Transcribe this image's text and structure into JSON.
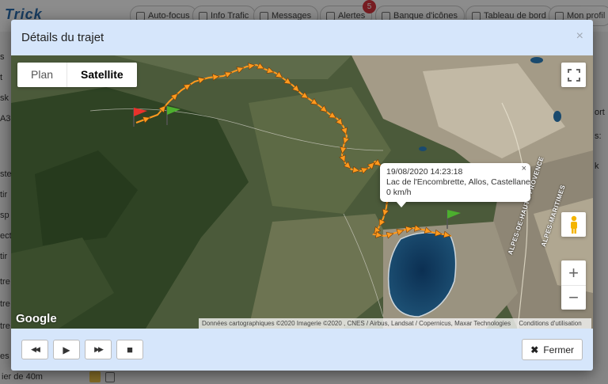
{
  "background": {
    "logo": "Trick",
    "nav": [
      {
        "label": "Auto-focus",
        "icon": "checkbox-icon"
      },
      {
        "label": "Info Trafic",
        "icon": "checkbox-icon"
      },
      {
        "label": "Messages",
        "icon": "envelope-icon"
      },
      {
        "label": "Alertes",
        "icon": "bell-icon"
      },
      {
        "label": "Banque d'icônes",
        "icon": "image-icon"
      },
      {
        "label": "Tableau de bord",
        "icon": "dashboard-icon"
      },
      {
        "label": "Mon profil",
        "icon": "user-icon"
      }
    ],
    "alerts_badge": "5",
    "sidebar_fragments": [
      "s",
      "t",
      "sk",
      "A3",
      "ste",
      "tir",
      "sp",
      "ect",
      "tir",
      "tre",
      "tre",
      "tre",
      "es"
    ],
    "right_fragments": [
      "ort",
      "s:",
      "k"
    ],
    "bottom_text": "ier de 40m"
  },
  "modal": {
    "title": "Détails du trajet",
    "close_symbol": "×"
  },
  "map": {
    "map_types": [
      "Plan",
      "Satellite"
    ],
    "active_map_type": "Satellite",
    "info_window": {
      "datetime": "19/08/2020 14:23:18",
      "address": "Lac de l'Encombrette, Allos, Castellane",
      "speed": "0 km/h",
      "close_symbol": "×"
    },
    "road_labels": [
      "ALPES-DE-HAUTE-PROVENCE",
      "ALPES-MARITIMES"
    ],
    "logo": "Google",
    "attribution": "Données cartographiques ©2020 Imagerie ©2020 , CNES / Airbus, Landsat / Copernicus, Maxar Technologies",
    "terms": "Conditions d'utilisation",
    "zoom_in": "+",
    "zoom_out": "−",
    "route_color": "#ff9a1f",
    "start_flag_color": "#e8322b",
    "end_flag_color": "#4caf2e"
  },
  "footer": {
    "buttons": [
      {
        "name": "rewind-button",
        "icon": "rewind-icon",
        "symbol": "◀◀"
      },
      {
        "name": "play-button",
        "icon": "play-icon",
        "symbol": "▶"
      },
      {
        "name": "fast-forward-button",
        "icon": "fast-forward-icon",
        "symbol": "▶▶"
      },
      {
        "name": "stop-button",
        "icon": "stop-icon",
        "symbol": "■"
      }
    ],
    "close_label": "Fermer",
    "close_symbol": "✖"
  }
}
